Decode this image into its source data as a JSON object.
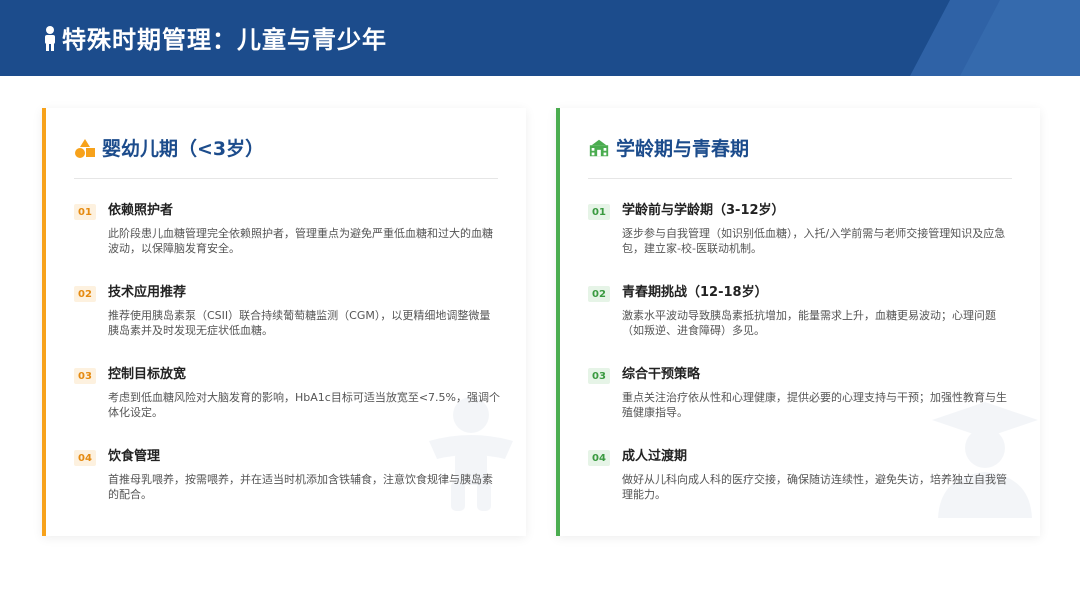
{
  "page": {
    "title": "特殊时期管理：儿童与青少年"
  },
  "colors": {
    "header": "#1c4c8c",
    "left_accent": "#f7a21b",
    "right_accent": "#4aac4f",
    "title_text": "#1c4c8c"
  },
  "left_card": {
    "icon": "shapes-icon",
    "title": "婴幼儿期（<3岁）",
    "items": [
      {
        "num": "01",
        "title": "依赖照护者",
        "text": "此阶段患儿血糖管理完全依赖照护者，管理重点为避免严重低血糖和过大的血糖波动，以保障脑发育安全。"
      },
      {
        "num": "02",
        "title": "技术应用推荐",
        "text": "推荐使用胰岛素泵（CSII）联合持续葡萄糖监测（CGM），以更精细地调整微量胰岛素并及时发现无症状低血糖。"
      },
      {
        "num": "03",
        "title": "控制目标放宽",
        "text": "考虑到低血糖风险对大脑发育的影响，HbA1c目标可适当放宽至<7.5%，强调个体化设定。"
      },
      {
        "num": "04",
        "title": "饮食管理",
        "text": "首推母乳喂养，按需喂养，并在适当时机添加含铁辅食，注意饮食规律与胰岛素的配合。"
      }
    ]
  },
  "right_card": {
    "icon": "school-icon",
    "title": "学龄期与青春期",
    "items": [
      {
        "num": "01",
        "title": "学龄前与学龄期（3-12岁）",
        "text": "逐步参与自我管理（如识别低血糖），入托/入学前需与老师交接管理知识及应急包，建立家-校-医联动机制。"
      },
      {
        "num": "02",
        "title": "青春期挑战（12-18岁）",
        "text": "激素水平波动导致胰岛素抵抗增加，能量需求上升，血糖更易波动；心理问题（如叛逆、进食障碍）多见。"
      },
      {
        "num": "03",
        "title": "综合干预策略",
        "text": "重点关注治疗依从性和心理健康，提供必要的心理支持与干预；加强性教育与生殖健康指导。"
      },
      {
        "num": "04",
        "title": "成人过渡期",
        "text": "做好从儿科向成人科的医疗交接，确保随访连续性，避免失访，培养独立自我管理能力。"
      }
    ]
  }
}
